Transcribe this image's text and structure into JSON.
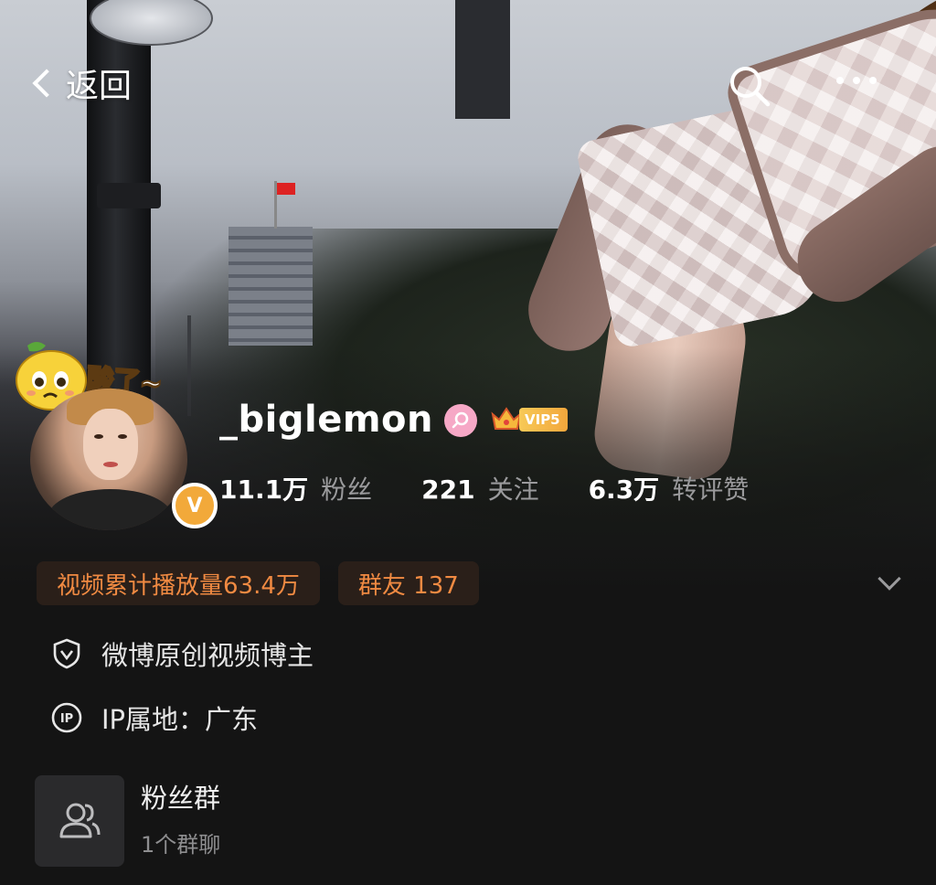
{
  "header": {
    "back_label": "返回",
    "icons": [
      "back-chevron-icon",
      "search-icon",
      "more-icon"
    ]
  },
  "profile": {
    "username": "_biglemon",
    "sticker_text": "酸了~",
    "gender": "female",
    "vip_label": "VIP5",
    "verified": true,
    "stats": [
      {
        "value": "11.1万",
        "label": "粉丝"
      },
      {
        "value": "221",
        "label": "关注"
      },
      {
        "value": "6.3万",
        "label": "转评赞"
      }
    ]
  },
  "chips": {
    "plays": "视频累计播放量63.4万",
    "group_friends": "群友 137"
  },
  "info": {
    "creator_tag": "微博原创视频博主",
    "ip_location": "IP属地：广东"
  },
  "fan_group": {
    "title": "粉丝群",
    "subtitle": "1个群聊"
  },
  "colors": {
    "background": "#141414",
    "accent_orange": "#f08a42",
    "vip_gold": "#f3a73c",
    "gender_pink": "#f6a8c6",
    "muted_text": "#9a9a9c"
  }
}
